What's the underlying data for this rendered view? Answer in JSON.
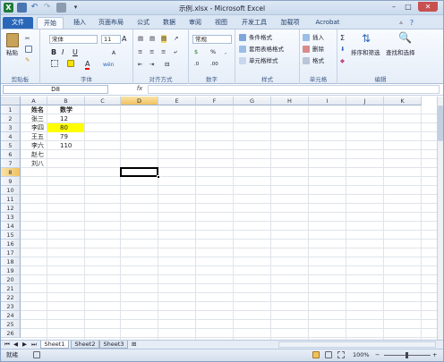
{
  "window": {
    "title": "示例.xlsx - Microsoft Excel",
    "min_glyph": "–",
    "max_glyph": "□",
    "close_glyph": "✕",
    "quick_access": [
      "save-icon",
      "undo-icon",
      "redo-icon",
      "print-icon",
      "quick-access-menu-icon"
    ]
  },
  "ribbon_tabs": [
    {
      "label": "文件",
      "kind": "file"
    },
    {
      "label": "开始",
      "kind": "active"
    },
    {
      "label": "插入",
      "kind": ""
    },
    {
      "label": "页面布局",
      "kind": ""
    },
    {
      "label": "公式",
      "kind": ""
    },
    {
      "label": "数据",
      "kind": ""
    },
    {
      "label": "审阅",
      "kind": ""
    },
    {
      "label": "视图",
      "kind": ""
    },
    {
      "label": "开发工具",
      "kind": ""
    },
    {
      "label": "加载项",
      "kind": ""
    },
    {
      "label": "Acrobat",
      "kind": ""
    }
  ],
  "ribbon": {
    "clipboard": {
      "label": "剪贴板",
      "paste": "粘贴"
    },
    "font": {
      "label": "字体",
      "font_name": "宋体",
      "font_size": "11",
      "bold": "B",
      "italic": "I",
      "underline": "U",
      "grow": "A",
      "shrink": "A",
      "color_a": "A",
      "phonetic": "wén"
    },
    "alignment": {
      "label": "对齐方式"
    },
    "number": {
      "label": "数字",
      "format": "常规",
      "currency": "$",
      "percent": "%",
      "comma": ",",
      "inc_dec": ".0",
      "dec_dec": ".00"
    },
    "styles": {
      "label": "样式",
      "conditional": "条件格式",
      "table": "套用表格格式",
      "cell": "单元格样式"
    },
    "cells": {
      "label": "单元格",
      "insert": "插入",
      "delete": "删除",
      "format": "格式"
    },
    "editing": {
      "label": "编辑",
      "sigma": "Σ",
      "sort": "排序和筛选",
      "find": "查找和选择"
    }
  },
  "formula_bar": {
    "name_box": "D8",
    "fx": "fx",
    "formula": ""
  },
  "columns": [
    "A",
    "B",
    "C",
    "D",
    "E",
    "F",
    "G",
    "H",
    "I",
    "J",
    "K"
  ],
  "rows": [
    "1",
    "2",
    "3",
    "4",
    "5",
    "6",
    "7",
    "8",
    "9",
    "10",
    "11",
    "12",
    "13",
    "14",
    "15",
    "16",
    "17",
    "18",
    "19",
    "20",
    "21",
    "22",
    "23",
    "24",
    "25",
    "26"
  ],
  "selected_cell": {
    "col": "D",
    "row": "8"
  },
  "cells": [
    {
      "ref": "A1",
      "value": "姓名",
      "bold": true
    },
    {
      "ref": "B1",
      "value": "数学",
      "bold": true
    },
    {
      "ref": "A2",
      "value": "张三"
    },
    {
      "ref": "B2",
      "value": "12"
    },
    {
      "ref": "A3",
      "value": "李四"
    },
    {
      "ref": "B3",
      "value": "80",
      "fill": "#ffff00"
    },
    {
      "ref": "A4",
      "value": "王五"
    },
    {
      "ref": "B4",
      "value": "79"
    },
    {
      "ref": "A5",
      "value": "李六"
    },
    {
      "ref": "B5",
      "value": "110"
    },
    {
      "ref": "A6",
      "value": "赵七"
    },
    {
      "ref": "A7",
      "value": "刘八"
    }
  ],
  "sheets": [
    {
      "name": "Sheet1",
      "active": true
    },
    {
      "name": "Sheet2",
      "active": false
    },
    {
      "name": "Sheet3",
      "active": false
    }
  ],
  "status": {
    "mode": "就绪",
    "zoom": "100%",
    "zoom_minus": "−",
    "zoom_plus": "+"
  },
  "colors": {
    "selection_border": "#000000",
    "highlight_fill": "#ffff00",
    "file_tab": "#2a67b8",
    "close_button": "#c75050"
  }
}
